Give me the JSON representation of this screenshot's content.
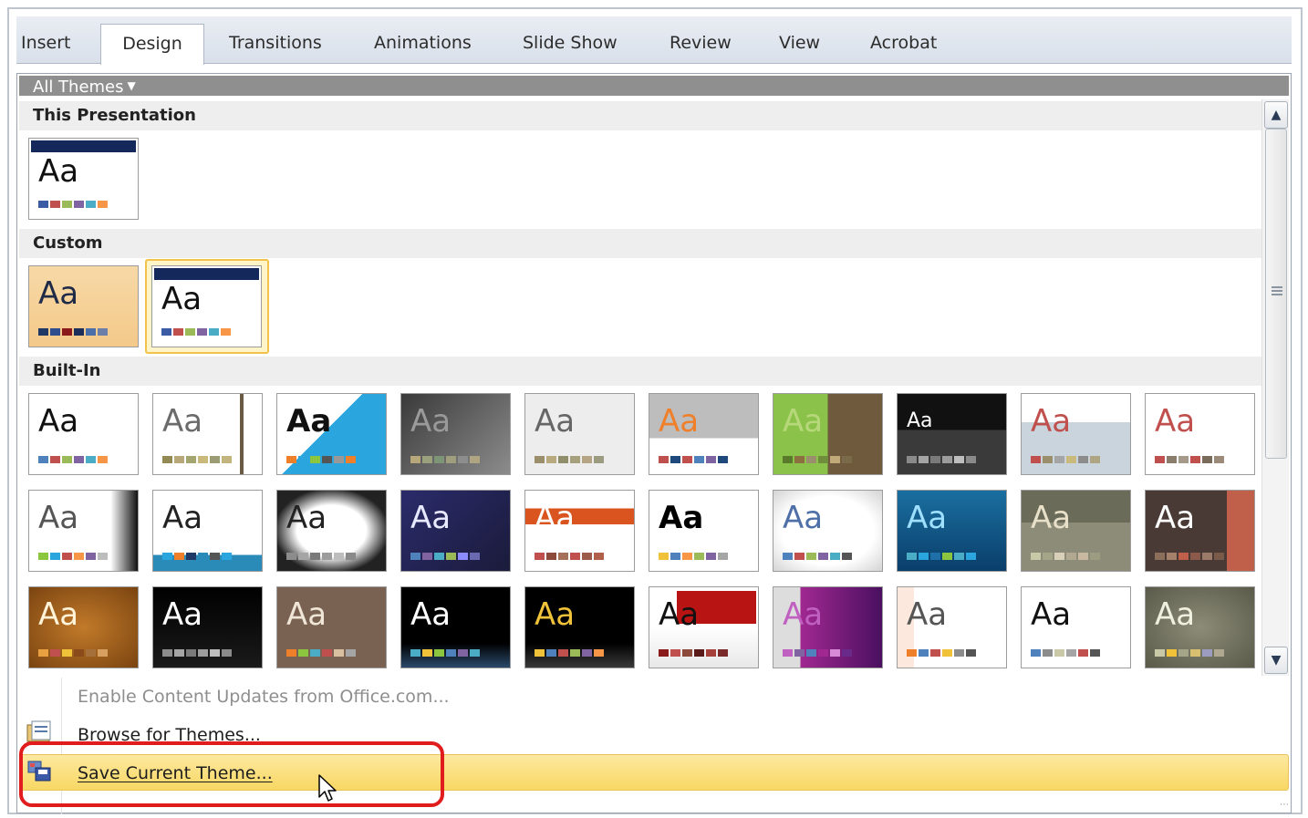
{
  "ribbon": {
    "tabs": [
      "Insert",
      "Design",
      "Transitions",
      "Animations",
      "Slide Show",
      "Review",
      "View",
      "Acrobat"
    ],
    "active_tab": "Design"
  },
  "gallery": {
    "header_label": "All Themes",
    "sections": {
      "this_presentation": "This Presentation",
      "custom": "Custom",
      "built_in": "Built-In"
    },
    "thumb_text": "Aa"
  },
  "menu": {
    "enable_updates": "Enable Content Updates from Office.com...",
    "browse": "Browse for Themes...",
    "save": "Save Current Theme..."
  },
  "icons": {
    "scroll_up": "scroll-up-arrow-icon",
    "scroll_down": "scroll-down-arrow-icon",
    "browse": "folder-icon",
    "save": "save-theme-icon",
    "cursor": "mouse-pointer-icon"
  },
  "colors": {
    "highlight": "#e11c1c",
    "hover_row": "#f8d763",
    "selected_theme": "#f2c24a"
  }
}
